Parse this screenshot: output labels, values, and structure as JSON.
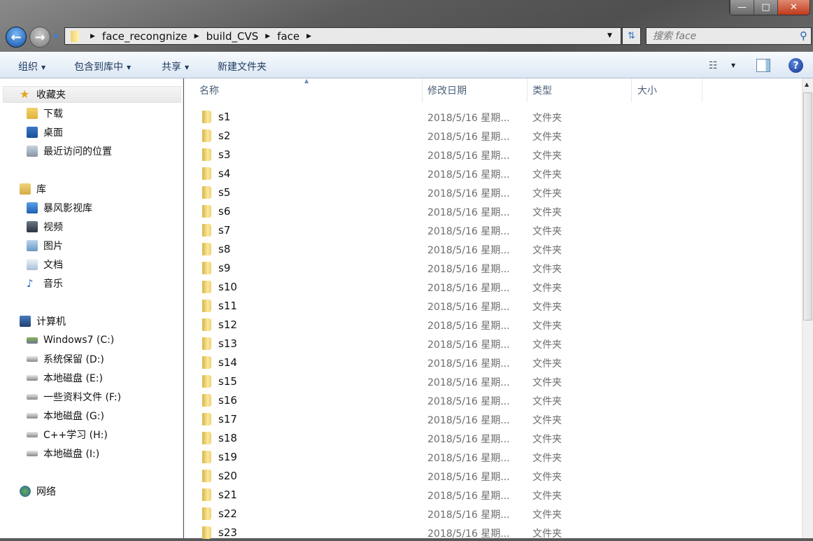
{
  "window": {
    "minimize": "—",
    "maximize": "□",
    "close": "✕"
  },
  "nav": {
    "back": "←",
    "forward": "→"
  },
  "address": {
    "segments": [
      "face_recongnize",
      "build_CVS",
      "face"
    ]
  },
  "search": {
    "placeholder": "搜索 face"
  },
  "toolbar": {
    "organize": "组织",
    "include_in_library": "包含到库中",
    "share": "共享",
    "new_folder": "新建文件夹"
  },
  "sidebar": {
    "favorites": {
      "label": "收藏夹",
      "items": [
        "下载",
        "桌面",
        "最近访问的位置"
      ]
    },
    "libraries": {
      "label": "库",
      "items": [
        "暴风影视库",
        "视频",
        "图片",
        "文档",
        "音乐"
      ]
    },
    "computer": {
      "label": "计算机",
      "items": [
        "Windows7 (C:)",
        "系统保留 (D:)",
        "本地磁盘 (E:)",
        "一些资料文件 (F:)",
        "本地磁盘 (G:)",
        "C++学习 (H:)",
        "本地磁盘 (I:)"
      ]
    },
    "network": {
      "label": "网络"
    }
  },
  "columns": {
    "name": "名称",
    "modified": "修改日期",
    "type": "类型",
    "size": "大小"
  },
  "files": [
    {
      "name": "s1",
      "modified": "2018/5/16 星期...",
      "type": "文件夹"
    },
    {
      "name": "s2",
      "modified": "2018/5/16 星期...",
      "type": "文件夹"
    },
    {
      "name": "s3",
      "modified": "2018/5/16 星期...",
      "type": "文件夹"
    },
    {
      "name": "s4",
      "modified": "2018/5/16 星期...",
      "type": "文件夹"
    },
    {
      "name": "s5",
      "modified": "2018/5/16 星期...",
      "type": "文件夹"
    },
    {
      "name": "s6",
      "modified": "2018/5/16 星期...",
      "type": "文件夹"
    },
    {
      "name": "s7",
      "modified": "2018/5/16 星期...",
      "type": "文件夹"
    },
    {
      "name": "s8",
      "modified": "2018/5/16 星期...",
      "type": "文件夹"
    },
    {
      "name": "s9",
      "modified": "2018/5/16 星期...",
      "type": "文件夹"
    },
    {
      "name": "s10",
      "modified": "2018/5/16 星期...",
      "type": "文件夹"
    },
    {
      "name": "s11",
      "modified": "2018/5/16 星期...",
      "type": "文件夹"
    },
    {
      "name": "s12",
      "modified": "2018/5/16 星期...",
      "type": "文件夹"
    },
    {
      "name": "s13",
      "modified": "2018/5/16 星期...",
      "type": "文件夹"
    },
    {
      "name": "s14",
      "modified": "2018/5/16 星期...",
      "type": "文件夹"
    },
    {
      "name": "s15",
      "modified": "2018/5/16 星期...",
      "type": "文件夹"
    },
    {
      "name": "s16",
      "modified": "2018/5/16 星期...",
      "type": "文件夹"
    },
    {
      "name": "s17",
      "modified": "2018/5/16 星期...",
      "type": "文件夹"
    },
    {
      "name": "s18",
      "modified": "2018/5/16 星期...",
      "type": "文件夹"
    },
    {
      "name": "s19",
      "modified": "2018/5/16 星期...",
      "type": "文件夹"
    },
    {
      "name": "s20",
      "modified": "2018/5/16 星期...",
      "type": "文件夹"
    },
    {
      "name": "s21",
      "modified": "2018/5/16 星期...",
      "type": "文件夹"
    },
    {
      "name": "s22",
      "modified": "2018/5/16 星期...",
      "type": "文件夹"
    },
    {
      "name": "s23",
      "modified": "2018/5/16 星期...",
      "type": "文件夹"
    }
  ]
}
